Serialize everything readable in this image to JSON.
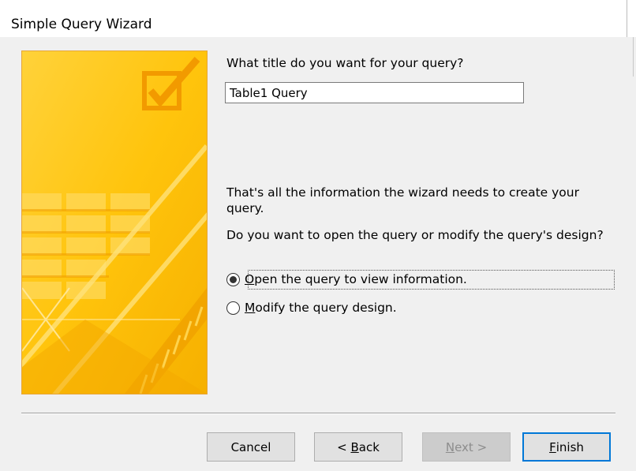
{
  "window": {
    "title": "Simple Query Wizard"
  },
  "query_title": {
    "label": "What title do you want for your query?",
    "value": "Table1 Query"
  },
  "info_text": "That's all the information the wizard needs to create your query.",
  "open_question": "Do you want to open the query or modify the query's design?",
  "options": [
    {
      "label": "Open the query to view information.",
      "mnemonic": "O",
      "rest": "pen the query to view information.",
      "selected": true
    },
    {
      "label": "Modify the query design.",
      "mnemonic": "M",
      "rest": "odify the query design.",
      "selected": false
    }
  ],
  "buttons": {
    "cancel": {
      "label": "Cancel"
    },
    "back": {
      "label": "< Back",
      "prefix": "< ",
      "mnemonic": "B",
      "rest": "ack"
    },
    "next": {
      "label": "Next >",
      "mnemonic": "N",
      "rest": "ext >",
      "enabled": false
    },
    "finish": {
      "label": "Finish",
      "mnemonic": "F",
      "rest": "inish",
      "default": true
    }
  },
  "colors": {
    "accent": "#0078d7",
    "art_yellow": "#ffc60a",
    "art_orange": "#f2a000",
    "art_border": "#e5a53a"
  },
  "icons": {
    "art": "checkbox-checkmark-icon"
  }
}
